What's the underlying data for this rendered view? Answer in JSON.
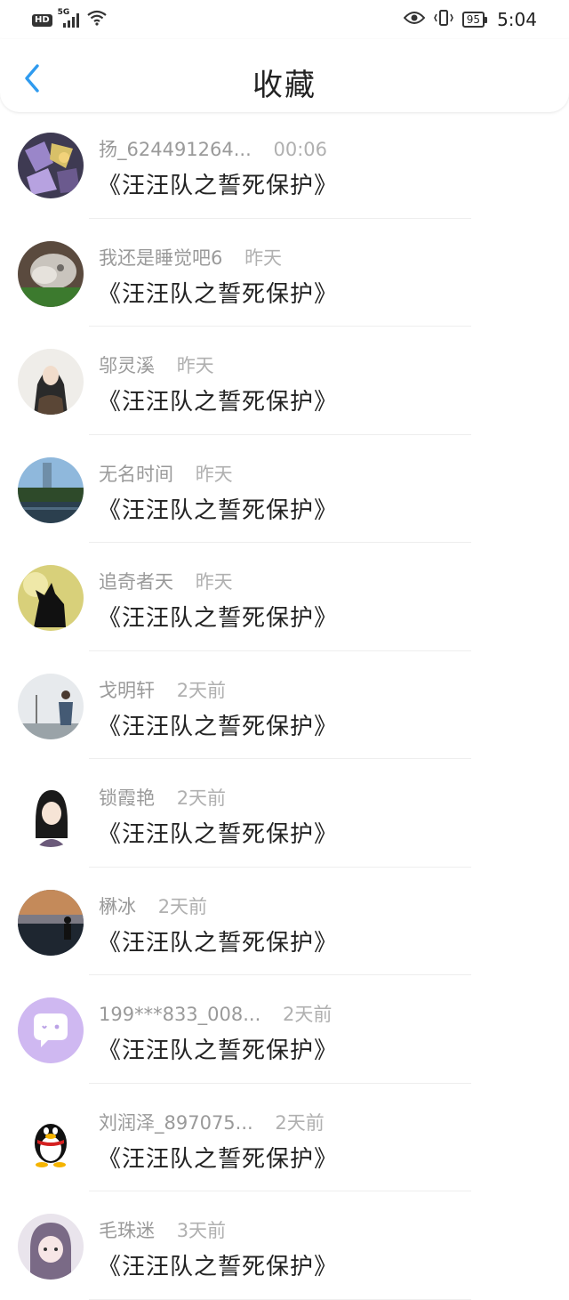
{
  "status_bar": {
    "hd": "HD",
    "network": "5G",
    "battery": "95",
    "time": "5:04"
  },
  "nav": {
    "title": "收藏"
  },
  "items": [
    {
      "name": "扬_624491264...",
      "time": "00:06",
      "content": "《汪汪队之誓死保护》"
    },
    {
      "name": "我还是睡觉吧6",
      "time": "昨天",
      "content": "《汪汪队之誓死保护》"
    },
    {
      "name": "邬灵溪",
      "time": "昨天",
      "content": "《汪汪队之誓死保护》"
    },
    {
      "name": "无名时间",
      "time": "昨天",
      "content": "《汪汪队之誓死保护》"
    },
    {
      "name": "追奇者天",
      "time": "昨天",
      "content": "《汪汪队之誓死保护》"
    },
    {
      "name": "戈明轩",
      "time": "2天前",
      "content": "《汪汪队之誓死保护》"
    },
    {
      "name": "锁霞艳",
      "time": "2天前",
      "content": "《汪汪队之誓死保护》"
    },
    {
      "name": "楙冰",
      "time": "2天前",
      "content": "《汪汪队之誓死保护》"
    },
    {
      "name": "199***833_008...",
      "time": "2天前",
      "content": "《汪汪队之誓死保护》"
    },
    {
      "name": "刘润泽_897075...",
      "time": "2天前",
      "content": "《汪汪队之誓死保护》"
    },
    {
      "name": "毛珠迷",
      "time": "3天前",
      "content": "《汪汪队之誓死保护》"
    }
  ],
  "colors": {
    "accent": "#2f9bef",
    "title": "#222222",
    "meta": "#9a9a9a",
    "divider": "#eeeeee"
  }
}
